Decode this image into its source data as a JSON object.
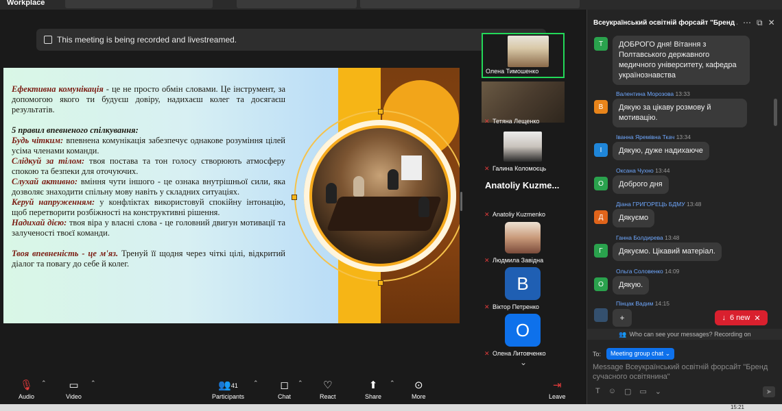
{
  "topbar": {
    "brand": "Workplace"
  },
  "banner": {
    "text": "This meeting is being recorded and livestreamed.",
    "ok_label": "OK",
    "info_glyph": "i"
  },
  "slide": {
    "intro_term": "Ефективна комунікація",
    "intro_text": " - це не просто обмін словами. Це інструмент, за допомогою якого ти будуєш довіру, надихаєш колег та досягаєш результатів.",
    "rules_title": "5 правил впевненого спілкування:",
    "rules": [
      {
        "term": "Будь чітким:",
        "text": " впевнена комунікація забезпечує однакове розуміння цілей усіма членами команди."
      },
      {
        "term": "Слідкуй за тілом:",
        "text": " твоя постава та тон голосу створюють атмосферу спокою та безпеки для оточуючих."
      },
      {
        "term": "Слухай активно:",
        "text": " вміння чути іншого - це ознака внутрішньої сили, яка дозволяє знаходити спільну мову навіть у складних ситуаціях."
      },
      {
        "term": "Керуй напруженням:",
        "text": " у конфліктах використовуй спокійну інтонацію, щоб перетворити розбіжності на конструктивні рішення."
      },
      {
        "term": "Надихай дією:",
        "text": " твоя віра у власні слова - це головний двигун мотивації та залученості твоєї команди."
      }
    ],
    "closing_term": "Твоя впевненість - це м'яз.",
    "closing_text": " Тренуй її щодня через чіткі цілі, відкритий діалог та повагу до себе й колег."
  },
  "gallery": {
    "tiles": [
      {
        "name": "Олена Тимошенко",
        "kind": "video",
        "active": true,
        "muted": false
      },
      {
        "name": "Тетяна Лещенко",
        "kind": "video",
        "active": false,
        "muted": true
      },
      {
        "name": "Галина Коломоєць",
        "kind": "video",
        "active": false,
        "muted": true
      },
      {
        "name": "Anatoliy Kuzmenko",
        "kind": "name",
        "bigname": "Anatoliy  Kuzme...",
        "active": false,
        "muted": true
      },
      {
        "name": "Людмила Завідна",
        "kind": "video",
        "active": false,
        "muted": true
      },
      {
        "name": "Віктор Петренко",
        "kind": "avatar",
        "letter": "B",
        "color": "#1f5fb3",
        "active": false,
        "muted": true
      },
      {
        "name": "Олена Литовченко",
        "kind": "avatar",
        "letter": "O",
        "color": "#0e71eb",
        "active": false,
        "muted": true
      }
    ],
    "scroll_glyph": "⌄"
  },
  "chat": {
    "title": "Всеукраїнський освітній форсайт \"Бренд ...",
    "messages": [
      {
        "sender": "",
        "time": "",
        "initial": "Т",
        "color": "#2aa24d",
        "text": "ДОБРОГО дня! Вітання з Полтавського державного медичного університету, кафедра українознавства"
      },
      {
        "sender": "Валентина Морозова",
        "time": "13:33",
        "initial": "В",
        "color": "#e8841a",
        "text": "Дякую за цікаву розмову й мотивацію."
      },
      {
        "sender": "Іванна Яремівна Ткач",
        "time": "13:34",
        "initial": "І",
        "color": "#1f86d9",
        "text": "Дякую, дуже надихаюче"
      },
      {
        "sender": "Оксана Чухно",
        "time": "13:44",
        "initial": "О",
        "color": "#2aa24d",
        "text": "Доброго дня"
      },
      {
        "sender": "Діана ГРИГОРЕЦЬ БДМУ",
        "time": "13:48",
        "initial": "Д",
        "color": "#e0641a",
        "text": "Дякуємо"
      },
      {
        "sender": "Ганна Болдирева",
        "time": "13:48",
        "initial": "Г",
        "color": "#2aa24d",
        "text": "Дякуємо. Цікавий матеріал."
      },
      {
        "sender": "Ольга Соловенко",
        "time": "14:09",
        "initial": "О",
        "color": "#2aa24d",
        "text": "Дякую."
      },
      {
        "sender": "Пінцак Вадим",
        "time": "14:15",
        "initial": "",
        "color": "#34506e",
        "text": ""
      }
    ],
    "plus_label": "+",
    "new_badge": "6 new",
    "who_text": "Who can see your messages? Recording on",
    "to_label": "To:",
    "to_value": "Meeting group chat ⌄",
    "compose_placeholder": "Message Всеукраїнський освітній форсайт \"Бренд сучасного освітянина\""
  },
  "toolbar": {
    "audio": "Audio",
    "video": "Video",
    "participants": "Participants",
    "participants_count": "41",
    "chat": "Chat",
    "react": "React",
    "share": "Share",
    "more": "More",
    "leave": "Leave"
  },
  "taskbar": {
    "clock": "15:21"
  }
}
